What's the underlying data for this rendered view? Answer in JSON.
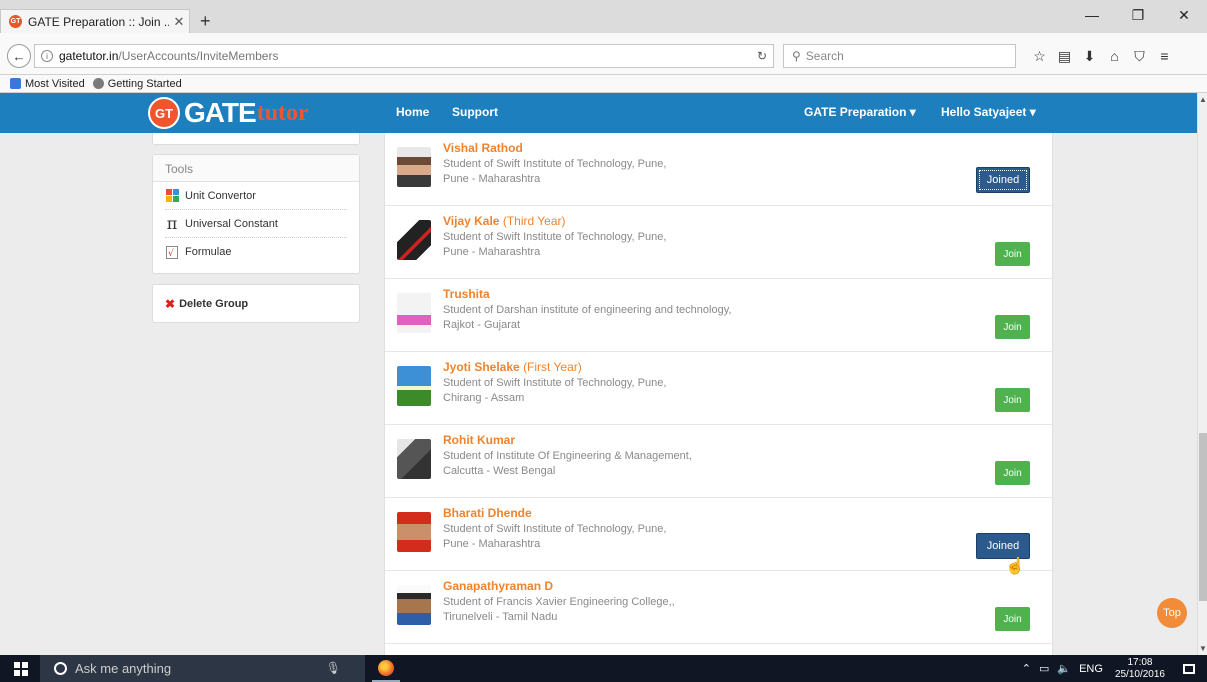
{
  "browser": {
    "tab_title": "GATE Preparation :: Join ...",
    "tab_close": "✕",
    "new_tab": "+",
    "url_domain": "gatetutor.in",
    "url_path": "/UserAccounts/InviteMembers",
    "search_placeholder": "Search",
    "bookmarks": [
      "Most Visited",
      "Getting Started"
    ],
    "window_buttons": [
      "—",
      "❐",
      "✕"
    ]
  },
  "header": {
    "logo_badge": "GT",
    "logo_text_1": "GATE",
    "logo_text_2": "tutor",
    "nav": [
      "Home",
      "Support"
    ],
    "menu_gate": "GATE Preparation ▾",
    "menu_user": "Hello Satyajeet ▾"
  },
  "sidebar": {
    "tools_title": "Tools",
    "tools": [
      {
        "label": "Unit Convertor",
        "icon": "unit-convertor-icon"
      },
      {
        "label": "Universal Constant",
        "icon": "pi-icon"
      },
      {
        "label": "Formulae",
        "icon": "formula-icon"
      }
    ],
    "delete_group": "Delete Group"
  },
  "members": [
    {
      "name": "Vishal Rathod",
      "year": "",
      "line1": "Student of Swift Institute of Technology, Pune,",
      "line2": "Pune - Maharashtra",
      "status": "Joined"
    },
    {
      "name": "Vijay Kale",
      "year": "(Third Year)",
      "line1": "Student of Swift Institute of Technology, Pune,",
      "line2": "Pune - Maharashtra",
      "status": "Join"
    },
    {
      "name": "Trushita",
      "year": "",
      "line1": "Student of Darshan institute of engineering and technology,",
      "line2": "Rajkot - Gujarat",
      "status": "Join"
    },
    {
      "name": "Jyoti Shelake",
      "year": "(First Year)",
      "line1": "Student of Swift Institute of Technology, Pune,",
      "line2": "Chirang - Assam",
      "status": "Join"
    },
    {
      "name": "Rohit Kumar",
      "year": "",
      "line1": "Student of Institute Of Engineering & Management,",
      "line2": "Calcutta - West Bengal",
      "status": "Join"
    },
    {
      "name": "Bharati Dhende",
      "year": "",
      "line1": "Student of Swift Institute of Technology, Pune,",
      "line2": "Pune - Maharashtra",
      "status": "Joined"
    },
    {
      "name": "Ganapathyraman D",
      "year": "",
      "line1": "Student of Francis Xavier Engineering College,,",
      "line2": "Tirunelveli - Tamil Nadu",
      "status": "Join"
    }
  ],
  "top_button": "Top",
  "taskbar": {
    "search_placeholder": "Ask me anything",
    "language": "ENG",
    "time": "17:08",
    "date": "25/10/2016"
  },
  "colors": {
    "header_blue": "#1d7fbd",
    "accent_orange": "#f0832d",
    "join_green": "#4fb24f",
    "joined_blue": "#2c5a8c"
  }
}
